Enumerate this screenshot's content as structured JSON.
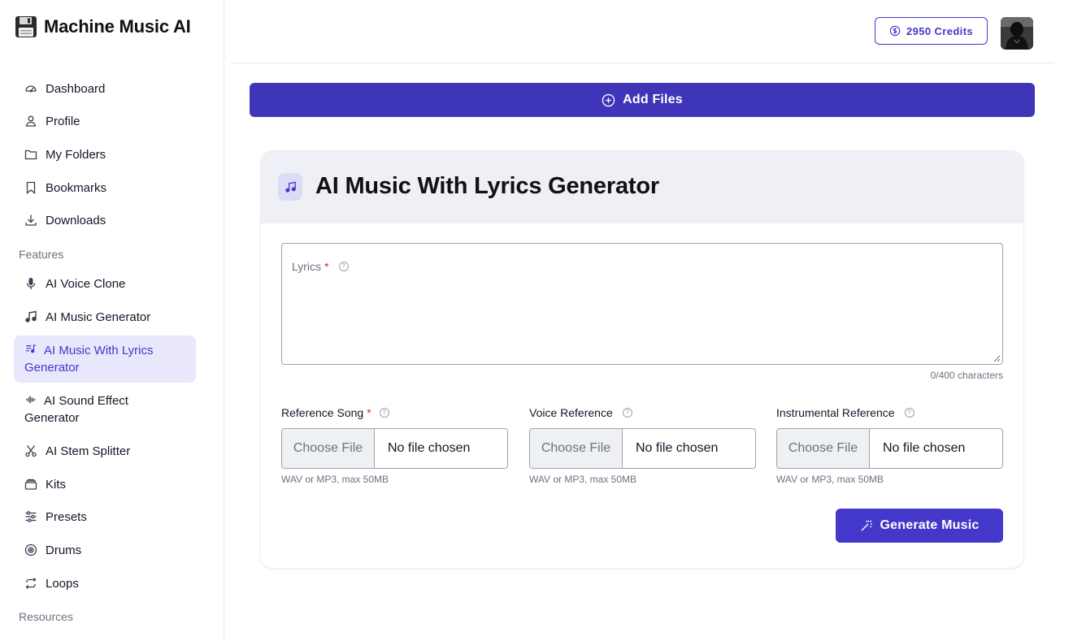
{
  "brand": {
    "name": "Machine Music AI",
    "logo_icon": "floppy-disk-icon"
  },
  "sidebar": {
    "items": [
      {
        "label": "Dashboard",
        "icon": "gauge-icon"
      },
      {
        "label": "Profile",
        "icon": "user-icon"
      },
      {
        "label": "My Folders",
        "icon": "folder-icon"
      },
      {
        "label": "Bookmarks",
        "icon": "bookmark-icon"
      },
      {
        "label": "Downloads",
        "icon": "download-icon"
      }
    ],
    "features_label": "Features",
    "features": [
      {
        "label": "AI Voice Clone",
        "icon": "microphone-icon"
      },
      {
        "label": "AI Music Generator",
        "icon": "music-note-icon"
      },
      {
        "label": "AI Music With Lyrics Generator",
        "icon": "lyrics-list-icon",
        "active": true
      },
      {
        "label": "AI Sound Effect Generator",
        "icon": "waveform-icon"
      },
      {
        "label": "AI Stem Splitter",
        "icon": "scissors-icon"
      },
      {
        "label": "Kits",
        "icon": "kit-box-icon"
      },
      {
        "label": "Presets",
        "icon": "sliders-icon"
      },
      {
        "label": "Drums",
        "icon": "drum-icon"
      },
      {
        "label": "Loops",
        "icon": "loop-icon"
      }
    ],
    "resources_label": "Resources"
  },
  "header": {
    "credits_label": "2950 Credits"
  },
  "main": {
    "add_files_label": "Add Files",
    "card": {
      "title": "AI Music With Lyrics Generator",
      "lyrics": {
        "label": "Lyrics",
        "required_mark": "*",
        "help": "?",
        "value": "",
        "counter": "0/400 characters"
      },
      "references": [
        {
          "label": "Reference Song",
          "required": true,
          "required_mark": "*",
          "help": "?",
          "button": "Choose File",
          "status": "No file chosen",
          "hint": "WAV or MP3, max 50MB"
        },
        {
          "label": "Voice Reference",
          "required": false,
          "help": "?",
          "button": "Choose File",
          "status": "No file chosen",
          "hint": "WAV or MP3, max 50MB"
        },
        {
          "label": "Instrumental Reference",
          "required": false,
          "help": "?",
          "button": "Choose File",
          "status": "No file chosen",
          "hint": "WAV or MP3, max 50MB"
        }
      ],
      "generate_label": "Generate Music"
    }
  }
}
